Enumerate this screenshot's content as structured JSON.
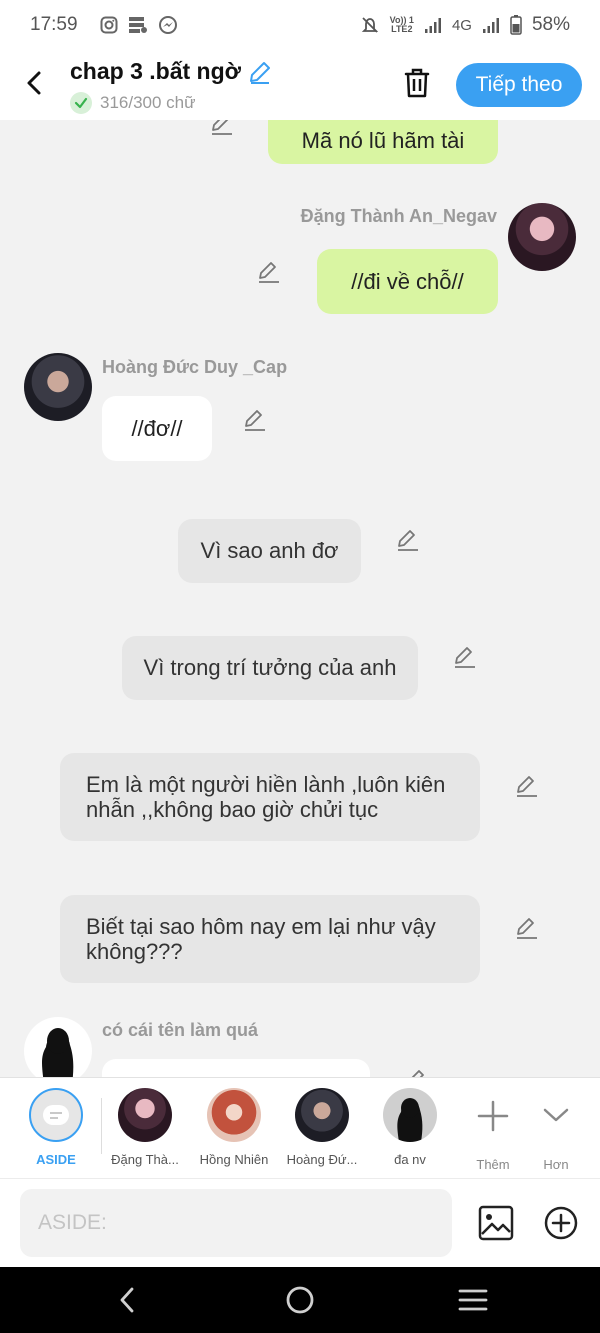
{
  "status_bar": {
    "time": "17:59",
    "network_top": "Vo)) 1",
    "network_bottom": "LTE2",
    "network_type": "4G",
    "battery": "58%"
  },
  "header": {
    "title": "chap 3 .bất ngờ",
    "word_count": "316/300 chữ",
    "next_label": "Tiếp theo"
  },
  "messages": [
    {
      "type": "right",
      "text": "Mã nó lũ hãm tài"
    },
    {
      "type": "right",
      "sender": "Đặng Thành An_Negav",
      "text": "//đi về chỗ//"
    },
    {
      "type": "left",
      "sender": "Hoàng Đức Duy _Cap",
      "text": "//đơ//"
    },
    {
      "type": "aside",
      "text": "Vì sao anh đơ"
    },
    {
      "type": "aside",
      "text": "Vì trong trí tưởng của anh"
    },
    {
      "type": "aside",
      "text": "Em là một người hiền lành ,luôn kiên nhẫn ,,không bao giờ chửi tục"
    },
    {
      "type": "aside",
      "text": "Biết tại sao hôm nay em lại như vậy không???"
    },
    {
      "type": "left",
      "sender": "có cái tên làm quá",
      "text": ""
    }
  ],
  "characters": [
    {
      "label": "ASIDE"
    },
    {
      "label": "Đặng Thà..."
    },
    {
      "label": "Hồng Nhiên"
    },
    {
      "label": "Hoàng Đứ..."
    },
    {
      "label": "đa nv"
    },
    {
      "label": "Thêm"
    },
    {
      "label": "Hơn"
    }
  ],
  "input": {
    "placeholder": "ASIDE:"
  },
  "colors": {
    "accent": "#3aa0f2",
    "green_bubble": "#d9f5a2",
    "aside_bubble": "#e6e6e6"
  }
}
